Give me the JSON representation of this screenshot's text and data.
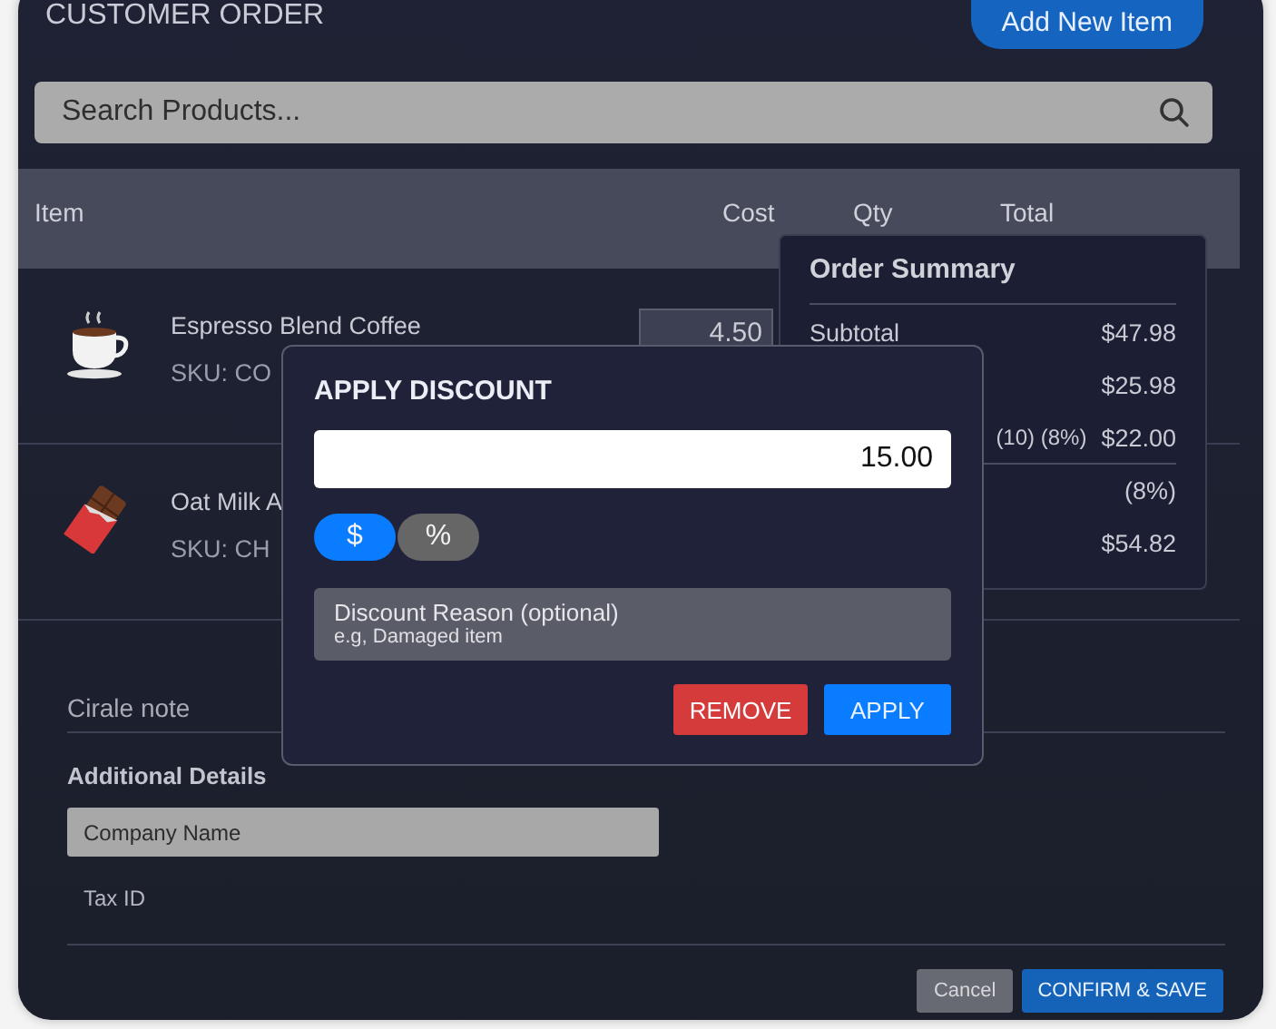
{
  "header": {
    "title": "CUSTOMER ORDER",
    "add_button": "Add New Item"
  },
  "search": {
    "placeholder": "Search Products..."
  },
  "table": {
    "columns": [
      "Item",
      "Cost",
      "Qty",
      "Total"
    ],
    "rows": [
      {
        "kind": "coffee",
        "name": "Espresso Blend Coffee",
        "sku": "SKU: CO",
        "cost": "4.50"
      },
      {
        "kind": "chocolate",
        "name": "Oat Milk A",
        "sku": "SKU: CH"
      }
    ]
  },
  "order_summary": {
    "title": "Order Summary",
    "rows": [
      {
        "label": "Subtotal",
        "value": "$47.98",
        "rule_above": false
      },
      {
        "value": "$25.98",
        "rule_above": false
      },
      {
        "note": "(10) (8%)",
        "value": "$22.00",
        "rule_above": false
      },
      {
        "value": "(8%)",
        "rule_above": true
      },
      {
        "value": "$54.82",
        "rule_above": false
      }
    ]
  },
  "discount_dialog": {
    "title": "APPLY DISCOUNT",
    "amount": "15.00",
    "modes": [
      {
        "label": "$",
        "selected": true
      },
      {
        "label": "%",
        "selected": false
      }
    ],
    "reason": {
      "label": "Discount Reason (optional)",
      "placeholder": "e.g, Damaged item"
    },
    "buttons": [
      {
        "label": "REMOVE",
        "kind": "danger"
      },
      {
        "label": "APPLY",
        "kind": "primary"
      }
    ]
  },
  "notes": {
    "placeholder": "Cirale note"
  },
  "additional_details": {
    "title": "Additional Details",
    "fields": [
      {
        "placeholder": "Company Name",
        "kind": "filled"
      },
      {
        "placeholder": "Tax ID",
        "kind": "plain"
      }
    ]
  },
  "footer": {
    "buttons": [
      {
        "label": "Cancel",
        "kind": "secondary"
      },
      {
        "label": "CONFIRM & SAVE",
        "kind": "primary"
      }
    ]
  }
}
